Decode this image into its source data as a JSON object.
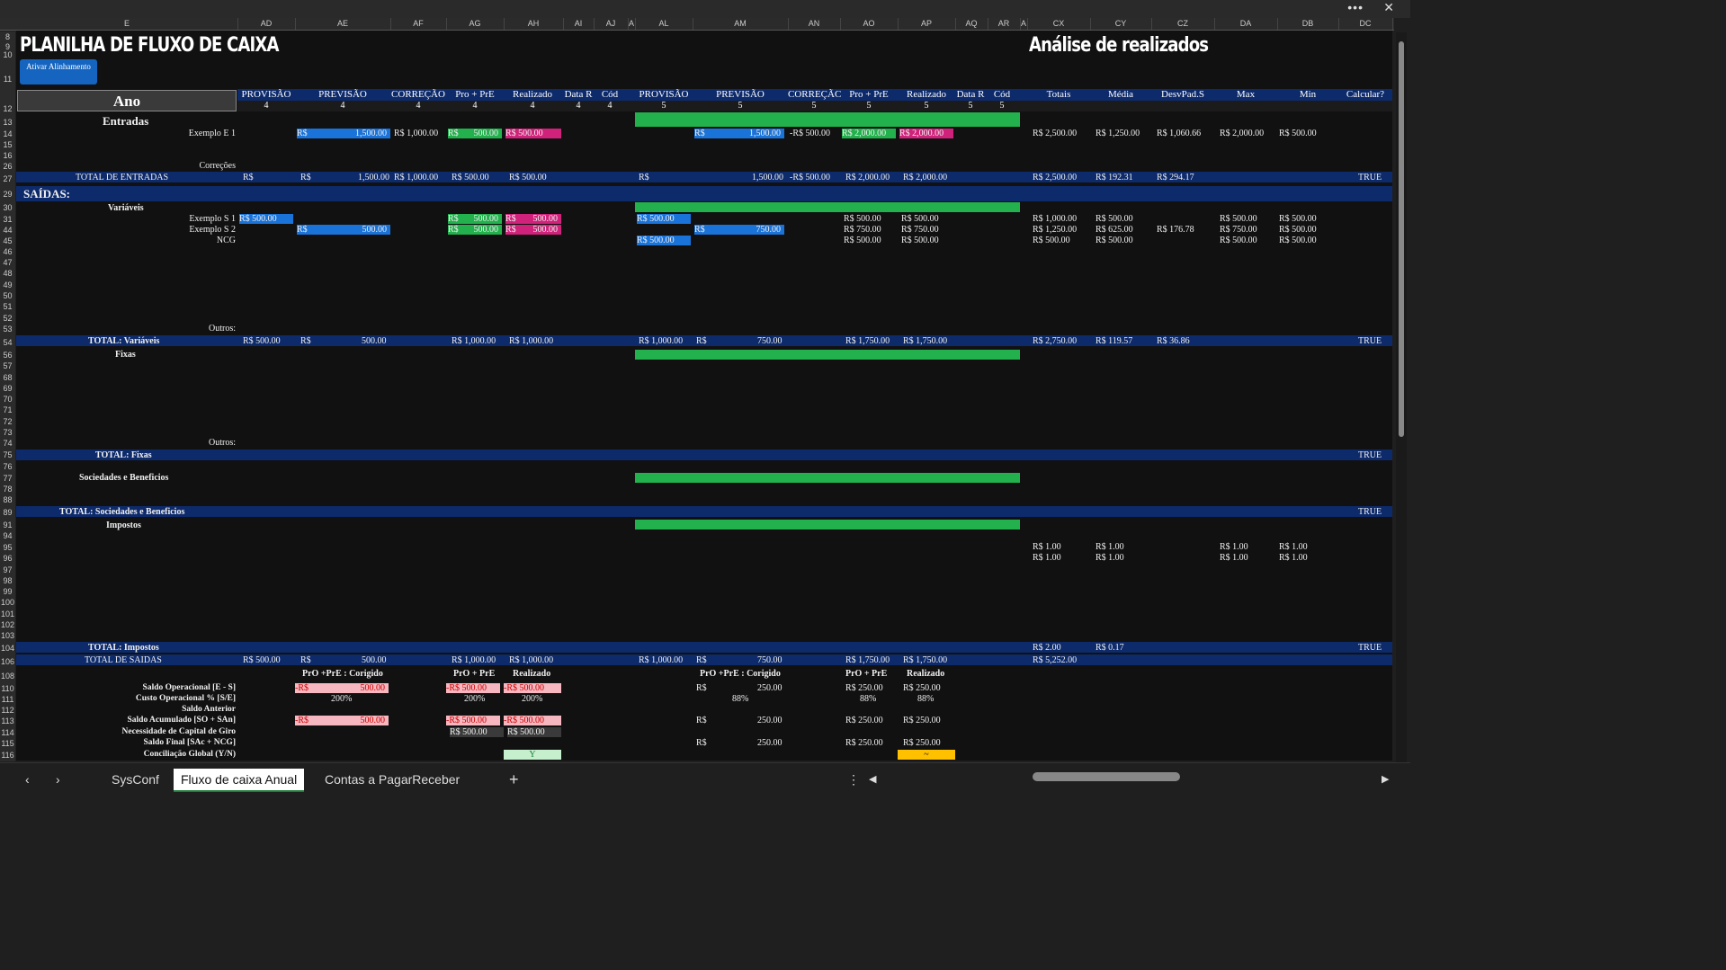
{
  "window": {
    "more_label": "•••",
    "close_label": "✕"
  },
  "columns": [
    "E",
    "AD",
    "AE",
    "AF",
    "AG",
    "AH",
    "AI",
    "AJ",
    "A",
    "AL",
    "AM",
    "AN",
    "AO",
    "AP",
    "AQ",
    "AR",
    "A",
    "CX",
    "CY",
    "CZ",
    "DA",
    "DB",
    "DC"
  ],
  "sheet_title": "PLANILHA DE FLUXO DE CAIXA",
  "analise_title": "Análise de realizados",
  "align_button": "Ativar Alinhamento",
  "ano_label": "Ano",
  "headers_left": [
    "PROVISÃO",
    "PREVISÃO",
    "CORREÇÃO",
    "Pro + PrE",
    "Realizado",
    "Data R",
    "Cód"
  ],
  "headers_mid": [
    "PROVISÃO",
    "PREVISÃO",
    "CORREÇÃC",
    "Pro + PrE",
    "Realizado",
    "Data R",
    "Cód"
  ],
  "headers_right": [
    "Totais",
    "Média",
    "DesvPad.S",
    "Max",
    "Min",
    "Calcular?"
  ],
  "nums_left": [
    "4",
    "4",
    "4",
    "4",
    "4",
    "4",
    "4"
  ],
  "nums_mid": [
    "5",
    "5",
    "5",
    "5",
    "5",
    "5",
    "5"
  ],
  "row_numbers": [
    "8",
    "9",
    "10",
    "11",
    "12",
    "13",
    "14",
    "15",
    "16",
    "26",
    "27",
    "29",
    "30",
    "31",
    "44",
    "45",
    "46",
    "47",
    "48",
    "49",
    "50",
    "51",
    "52",
    "53",
    "54",
    "56",
    "57",
    "68",
    "69",
    "70",
    "71",
    "72",
    "73",
    "74",
    "75",
    "76",
    "77",
    "78",
    "88",
    "89",
    "91",
    "94",
    "95",
    "96",
    "97",
    "98",
    "99",
    "100",
    "101",
    "102",
    "103",
    "104",
    "106",
    "108",
    "110",
    "111",
    "112",
    "113",
    "114",
    "115",
    "116"
  ],
  "sections": {
    "entradas": "Entradas",
    "exemplo_e1": "Exemplo E 1",
    "correcoes": "Correções",
    "total_entradas": "TOTAL DE ENTRADAS",
    "saidas": "SAÍDAS:",
    "variaveis": "Variáveis",
    "exemplo_s1": "Exemplo S 1",
    "exemplo_s2": "Exemplo S 2",
    "ncg": "NCG",
    "outros1": "Outros:",
    "total_variaveis": "TOTAL: Variáveis",
    "fixas": "Fixas",
    "outros2": "Outros:",
    "total_fixas": "TOTAL: Fixas",
    "sociedades": "Sociedades e Beneficios",
    "total_sociedades": "TOTAL: Sociedades e Beneficios",
    "impostos": "Impostos",
    "total_impostos": "TOTAL: Impostos",
    "total_saidas": "TOTAL DE SAIDAS"
  },
  "values": {
    "rs": "R$",
    "dash": "-",
    "e1_prev4": "1,500.00",
    "e1_corr4": "1,000.00",
    "e1_pro4": "500.00",
    "e1_real4": "500.00",
    "e1_prev5": "1,500.00",
    "e1_corr5": "500.00",
    "e1_pro5": "2,000.00",
    "e1_real5": "2,000.00",
    "e1_tot": "2,500.00",
    "e1_med": "1,250.00",
    "e1_dev": "1,060.66",
    "e1_max": "2,000.00",
    "e1_min": "500.00",
    "te_prev4": "1,500.00",
    "te_corr4": "1,000.00",
    "te_pro4": "500.00",
    "te_real4": "500.00",
    "te_prev5": "1,500.00",
    "te_corr5": "500.00",
    "te_pro5": "2,000.00",
    "te_real5": "2,000.00",
    "te_tot": "2,500.00",
    "te_med": "192.31",
    "te_dev": "294.17",
    "true": "TRUE",
    "s1_prov4": "500.00",
    "s1_pro4": "500.00",
    "s1_real4": "500.00",
    "s1_prov5": "500.00",
    "s1_pro5": "500.00",
    "s1_real5": "500.00",
    "s1_tot": "1,000.00",
    "s1_med": "500.00",
    "s1_max": "500.00",
    "s1_min": "500.00",
    "s2_prev4": "500.00",
    "s2_pro4": "500.00",
    "s2_real4": "500.00",
    "s2_prev5": "750.00",
    "s2_pro5": "750.00",
    "s2_real5": "750.00",
    "s2_tot": "1,250.00",
    "s2_med": "625.00",
    "s2_dev": "176.78",
    "s2_max": "750.00",
    "s2_min": "500.00",
    "ncg_prov5": "500.00",
    "ncg_pro5": "500.00",
    "ncg_real5": "500.00",
    "ncg_tot": "500.00",
    "ncg_med": "500.00",
    "ncg_max": "500.00",
    "ncg_min": "500.00",
    "tv_prov4": "500.00",
    "tv_prev4": "500.00",
    "tv_pro4": "1,000.00",
    "tv_real4": "1,000.00",
    "tv_prov5": "1,000.00",
    "tv_prev5": "750.00",
    "tv_pro5": "1,750.00",
    "tv_real5": "1,750.00",
    "tv_tot": "2,750.00",
    "tv_med": "119.57",
    "tv_dev": "36.86",
    "imp_one": "1.00",
    "ti_tot": "2.00",
    "ti_med": "0.17",
    "ts_prov4": "500.00",
    "ts_prev4": "500.00",
    "ts_pro4": "1,000.00",
    "ts_real4": "1,000.00",
    "ts_prov5": "1,000.00",
    "ts_prev5": "750.00",
    "ts_pro5": "1,750.00",
    "ts_real5": "1,750.00",
    "ts_tot": "5,252.00"
  },
  "summary": {
    "hdr_corrigido": "PrO +PrE : Corigido",
    "hdr_pro": "PrO + PrE",
    "hdr_real": "Realizado",
    "labels": [
      "Saldo Operacional [E - S]",
      "Custo Operacional % [S/E]",
      "Saldo Anterior",
      "Saldo Acumulado [SO + SAn]",
      "Necessidade de Capital de Giro",
      "Saldo Final [SAc + NCG]",
      "Conciliação Global (Y/N)"
    ],
    "neg_rs": "-R$",
    "v500": "500.00",
    "v250": "250.00",
    "p200": "200%",
    "p88": "88%",
    "yes": "Y",
    "tilde": "~"
  },
  "tabs": {
    "syscofig": "SysConf",
    "active": "Fluxo de caixa Anual",
    "contas": "Contas a PagarReceber",
    "add": "+"
  },
  "colors": {
    "navy": "#0d2a6b",
    "green": "#22b14c",
    "blue": "#1a73d9",
    "magenta": "#d0227a",
    "accent": "#1a7f37"
  }
}
